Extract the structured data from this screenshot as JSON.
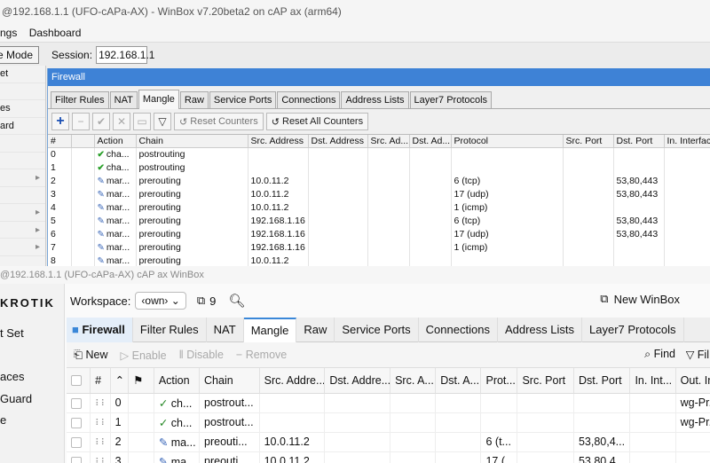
{
  "old": {
    "title": "@192.168.1.1 (UFO-cAPa-AX) - WinBox v7.20beta2 on cAP ax (arm64)",
    "menu": [
      "ngs",
      "Dashboard"
    ],
    "safe_mode": "e Mode",
    "session_label": "Session:",
    "session_value": "192.168.1.1",
    "sidebar": [
      "et",
      "",
      "es",
      "ard",
      "",
      "",
      "",
      "",
      "",
      "",
      "",
      ""
    ],
    "window_title": "Firewall",
    "tabs": [
      "Filter Rules",
      "NAT",
      "Mangle",
      "Raw",
      "Service Ports",
      "Connections",
      "Address Lists",
      "Layer7 Protocols"
    ],
    "reset_counters": "Reset Counters",
    "reset_all_counters": "Reset All Counters",
    "columns": [
      "#",
      "Action",
      "Chain",
      "Src. Address",
      "Dst. Address",
      "Src. Ad...",
      "Dst. Ad...",
      "Protocol",
      "Src. Port",
      "Dst. Port",
      "In. Interfac"
    ],
    "rows": [
      {
        "num": "0",
        "icon": "check",
        "action": "cha...",
        "chain": "postrouting",
        "src": "",
        "proto": "",
        "dport": ""
      },
      {
        "num": "1",
        "icon": "check",
        "action": "cha...",
        "chain": "postrouting",
        "src": "",
        "proto": "",
        "dport": ""
      },
      {
        "num": "2",
        "icon": "pen",
        "action": "mar...",
        "chain": "prerouting",
        "src": "10.0.11.2",
        "proto": "6 (tcp)",
        "dport": "53,80,443"
      },
      {
        "num": "3",
        "icon": "pen",
        "action": "mar...",
        "chain": "prerouting",
        "src": "10.0.11.2",
        "proto": "17 (udp)",
        "dport": "53,80,443"
      },
      {
        "num": "4",
        "icon": "pen",
        "action": "mar...",
        "chain": "prerouting",
        "src": "10.0.11.2",
        "proto": "1 (icmp)",
        "dport": ""
      },
      {
        "num": "5",
        "icon": "pen",
        "action": "mar...",
        "chain": "prerouting",
        "src": "192.168.1.16",
        "proto": "6 (tcp)",
        "dport": "53,80,443"
      },
      {
        "num": "6",
        "icon": "pen",
        "action": "mar...",
        "chain": "prerouting",
        "src": "192.168.1.16",
        "proto": "17 (udp)",
        "dport": "53,80,443"
      },
      {
        "num": "7",
        "icon": "pen",
        "action": "mar...",
        "chain": "prerouting",
        "src": "192.168.1.16",
        "proto": "1 (icmp)",
        "dport": ""
      },
      {
        "num": "8",
        "icon": "pen",
        "action": "mar...",
        "chain": "prerouting",
        "src": "10.0.11.2",
        "proto": "",
        "dport": ""
      }
    ]
  },
  "new": {
    "title": "@192.168.1.1 (UFO-cAPa-AX) cAP ax WinBox",
    "logo": "KROTIK",
    "sidebar": [
      "t Set",
      "",
      "aces",
      "Guard",
      "e"
    ],
    "workspace_label": "Workspace:",
    "workspace_value": "‹own›",
    "window_count": "9",
    "new_winbox": "New WinBox",
    "firewall_tab": "Firewall",
    "tabs": [
      "Filter Rules",
      "NAT",
      "Mangle",
      "Raw",
      "Service Ports",
      "Connections",
      "Address Lists",
      "Layer7 Protocols"
    ],
    "actions": {
      "new": "New",
      "enable": "Enable",
      "disable": "Disable",
      "remove": "Remove",
      "find": "Find",
      "filter": "Fil"
    },
    "columns": [
      "#",
      "Action",
      "Chain",
      "Src. Addre...",
      "Dst. Addre...",
      "Src. A...",
      "Dst. A...",
      "Prot...",
      "Src. Port",
      "Dst. Port",
      "In. Int...",
      "Out. In..."
    ],
    "rows": [
      {
        "num": "0",
        "icon": "check",
        "action": "ch...",
        "chain": "postrout...",
        "src": "",
        "proto": "",
        "dport": "",
        "out": "wg-Pr..."
      },
      {
        "num": "1",
        "icon": "check",
        "action": "ch...",
        "chain": "postrout...",
        "src": "",
        "proto": "",
        "dport": "",
        "out": "wg-Pr..."
      },
      {
        "num": "2",
        "icon": "pen",
        "action": "ma...",
        "chain": "preouti...",
        "src": "10.0.11.2",
        "proto": "6 (t...",
        "dport": "53,80,4...",
        "out": ""
      },
      {
        "num": "3",
        "icon": "pen",
        "action": "ma...",
        "chain": "preouti...",
        "src": "10.0.11.2",
        "proto": "17 (...",
        "dport": "53,80,4...",
        "out": ""
      }
    ]
  }
}
